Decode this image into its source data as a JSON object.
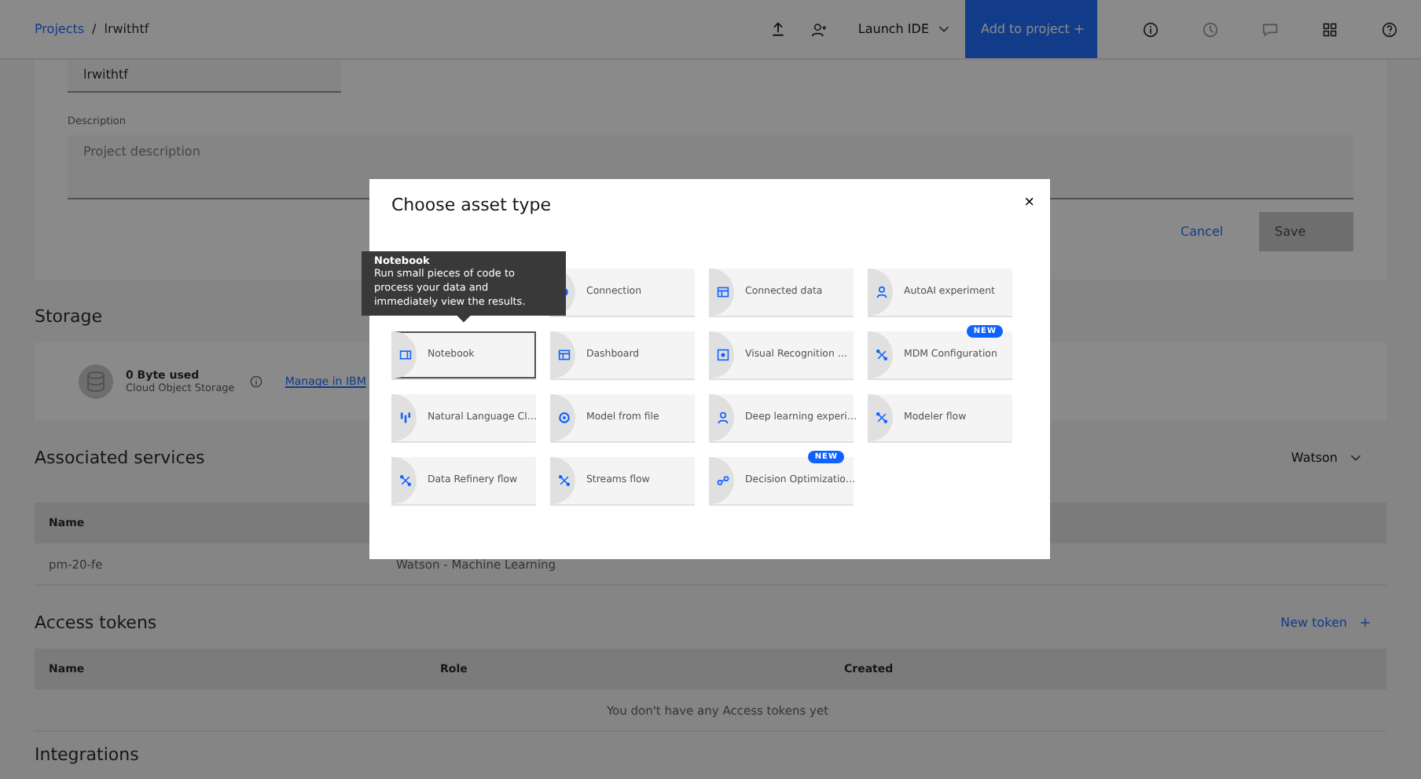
{
  "breadcrumb": {
    "link": "Projects",
    "separator": "/",
    "current": "lrwithtf"
  },
  "toolbar": {
    "launch": "Launch IDE",
    "add_button": "Add to project"
  },
  "details": {
    "name_value": "lrwithtf",
    "description_label": "Description",
    "description_placeholder": "Project description",
    "buttons": [
      {
        "label": "Cancel",
        "kind": "ghost"
      },
      {
        "label": "Save",
        "kind": "primary",
        "disabled": true
      }
    ]
  },
  "storage": {
    "heading": "Storage",
    "used": "0 Byte used",
    "service": "Cloud Object Storage",
    "link": "Manage in IBM"
  },
  "associated_services": {
    "heading": "Associated services",
    "filter": "Watson",
    "columns": [
      "Name"
    ],
    "rows": [
      [
        "pm-20-fe",
        "Watson - Machine Learning"
      ]
    ]
  },
  "access_tokens": {
    "heading": "Access tokens",
    "new_button": "New token",
    "columns": [
      "Name",
      "Role",
      "Created"
    ],
    "empty_message": "You don't have any Access tokens yet"
  },
  "integrations": {
    "heading": "Integrations"
  },
  "modal": {
    "title": "Choose asset type",
    "close": "×",
    "tiles": [
      {
        "label": "Connection",
        "selected": false
      },
      {
        "label": "Connected data",
        "selected": false
      },
      {
        "label": "AutoAI experiment",
        "selected": false
      },
      {
        "label": "Notebook",
        "selected": true
      },
      {
        "label": "Dashboard",
        "selected": false
      },
      {
        "label": "Visual Recognition …",
        "selected": false
      },
      {
        "label": "MDM Configuration",
        "selected": false,
        "badge": "NEW"
      },
      {
        "label": "Natural Language Cl…",
        "selected": false
      },
      {
        "label": "Model from file",
        "selected": false
      },
      {
        "label": "Deep learning experi…",
        "selected": false
      },
      {
        "label": "Modeler flow",
        "selected": false
      },
      {
        "label": "Data Refinery flow",
        "selected": false
      },
      {
        "label": "Streams flow",
        "selected": false
      },
      {
        "label": "Decision Optimizatio…",
        "selected": false,
        "badge": "NEW"
      }
    ],
    "tooltip": {
      "title": "Notebook",
      "text": "Run small pieces of code to process your data and immediately view the results."
    }
  }
}
